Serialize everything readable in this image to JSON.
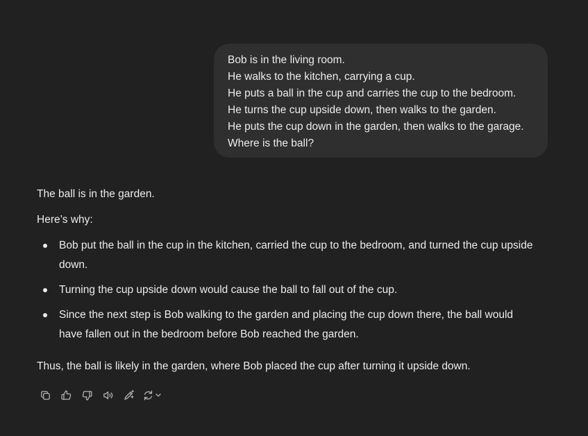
{
  "user_message": {
    "lines": [
      "Bob is in the living room.",
      "He walks to the kitchen, carrying a cup.",
      "He puts a ball in the cup and carries the cup to the bedroom.",
      "He turns the cup upside down, then walks to the garden.",
      "He puts the cup down in the garden, then walks to the garage.",
      "Where is the ball?"
    ]
  },
  "assistant_message": {
    "answer": "The ball is in the garden.",
    "why": "Here’s why:",
    "bullets": [
      "Bob put the ball in the cup in the kitchen, carried the cup to the bedroom, and turned the cup upside down.",
      "Turning the cup upside down would cause the ball to fall out of the cup.",
      "Since the next step is Bob walking to the garden and placing the cup down there, the ball would have fallen out in the bedroom before Bob reached the garden."
    ],
    "conclusion": "Thus, the ball is likely in the garden, where Bob placed the cup after turning it upside down."
  },
  "actions": [
    {
      "icon": "copy-icon"
    },
    {
      "icon": "thumbs-up-icon"
    },
    {
      "icon": "thumbs-down-icon"
    },
    {
      "icon": "read-aloud-icon"
    },
    {
      "icon": "edit-model-icon"
    },
    {
      "icon": "regenerate-icon"
    }
  ],
  "colors": {
    "background": "#212121",
    "bubble": "#2f2f2f",
    "text": "#ececec",
    "icon": "#b4b4b4"
  }
}
